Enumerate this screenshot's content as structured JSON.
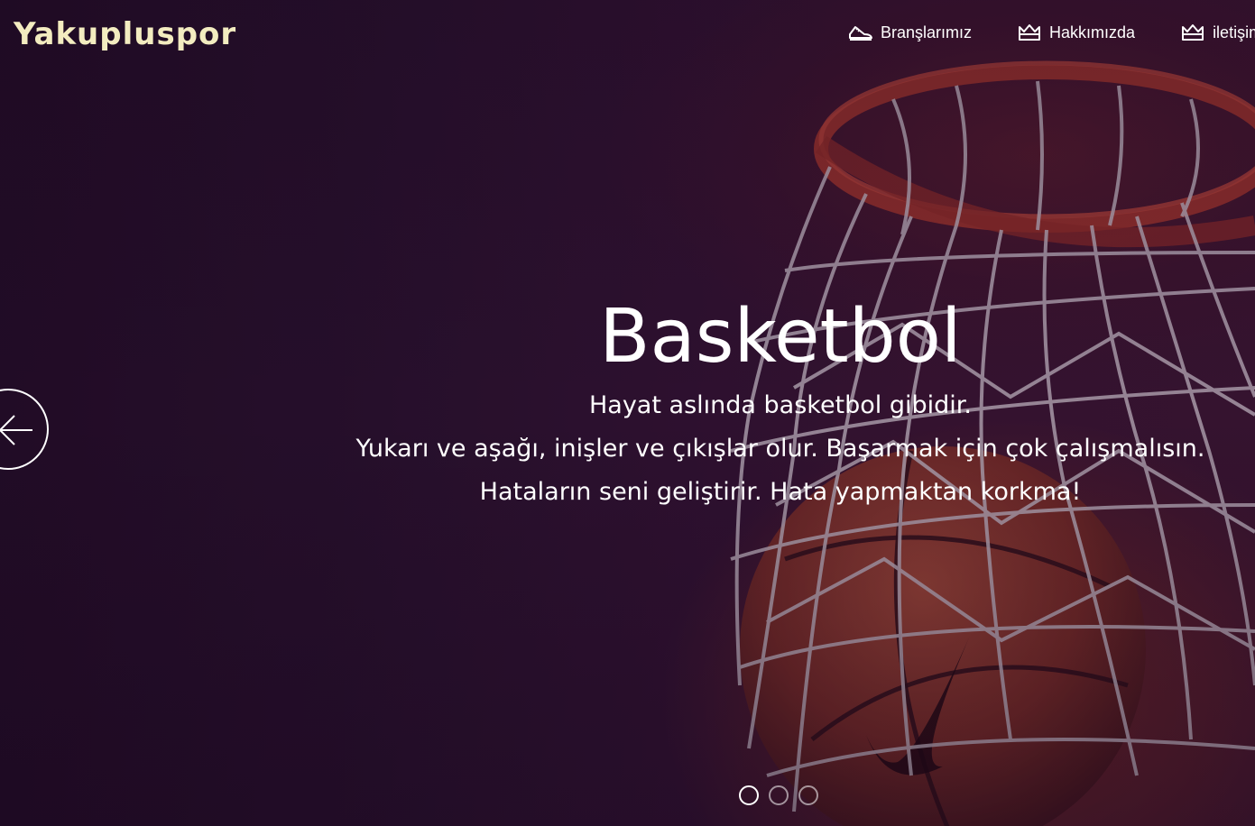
{
  "brand": {
    "name": "Yakupluspor"
  },
  "nav": {
    "items": [
      {
        "label": "Branşlarımız",
        "icon": "sneaker-icon"
      },
      {
        "label": "Hakkımızda",
        "icon": "crown-icon"
      },
      {
        "label": "iletişim",
        "icon": "crown-icon"
      }
    ]
  },
  "slide": {
    "title": "Basketbol",
    "lines": [
      "Hayat aslında basketbol gibidir.",
      "Yukarı ve aşağı, inişler ve çıkışlar olur. Başarmak için çok çalışmalısın.",
      "Hataların seni geliştirir. Hata yapmaktan korkma!"
    ]
  },
  "carousel": {
    "prev_icon": "arrow-left-icon",
    "slide_count": 3,
    "active_index": 0
  },
  "colors": {
    "brand": "#f3ecc0",
    "text": "#ffffff",
    "background": "#24102a",
    "accent": "#c0392b"
  }
}
